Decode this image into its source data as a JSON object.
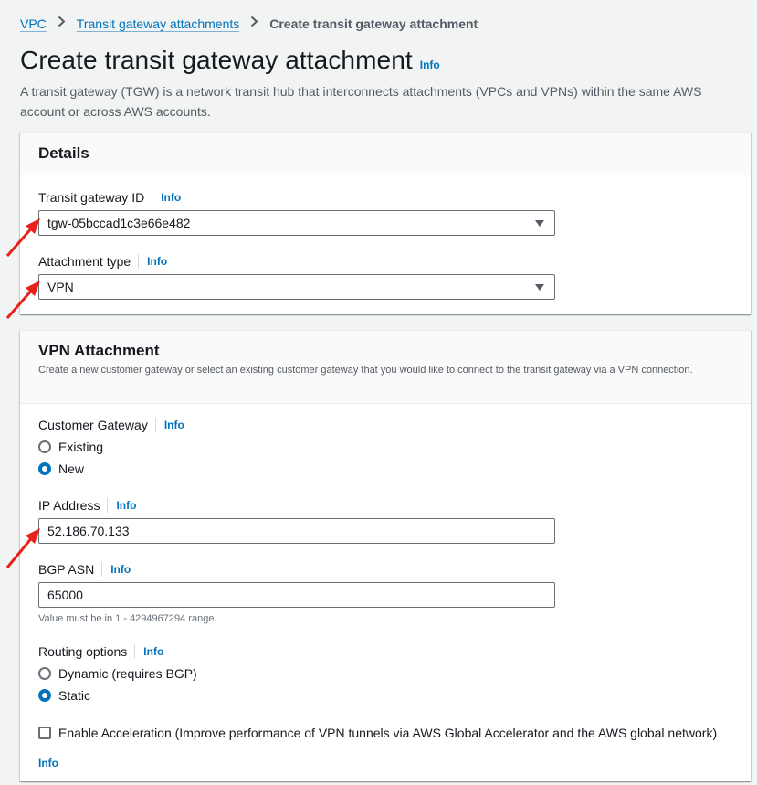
{
  "breadcrumb": {
    "items": [
      "VPC",
      "Transit gateway attachments"
    ],
    "current": "Create transit gateway attachment"
  },
  "page": {
    "title": "Create transit gateway attachment",
    "info": "Info",
    "description": "A transit gateway (TGW) is a network transit hub that interconnects attachments (VPCs and VPNs) within the same AWS account or across AWS accounts."
  },
  "details": {
    "heading": "Details",
    "tgw_label": "Transit gateway ID",
    "tgw_value": "tgw-05bccad1c3e66e482",
    "type_label": "Attachment type",
    "type_value": "VPN",
    "info": "Info"
  },
  "vpn": {
    "heading": "VPN Attachment",
    "subheading": "Create a new customer gateway or select an existing customer gateway that you would like to connect to the transit gateway via a VPN connection.",
    "cgw_label": "Customer Gateway",
    "cgw_options": [
      "Existing",
      "New"
    ],
    "cgw_selected": "New",
    "ip_label": "IP Address",
    "ip_value": "52.186.70.133",
    "asn_label": "BGP ASN",
    "asn_value": "65000",
    "asn_hint": "Value must be in 1 - 4294967294 range.",
    "routing_label": "Routing options",
    "routing_options": [
      "Dynamic (requires BGP)",
      "Static"
    ],
    "routing_selected": "Static",
    "accel_label": "Enable Acceleration (Improve performance of VPN tunnels via AWS Global Accelerator and the AWS global network)",
    "accel_checked": false,
    "info": "Info"
  },
  "colors": {
    "link": "#0073bb",
    "annotation_arrow": "#e8221b",
    "background": "#f2f3f3"
  }
}
